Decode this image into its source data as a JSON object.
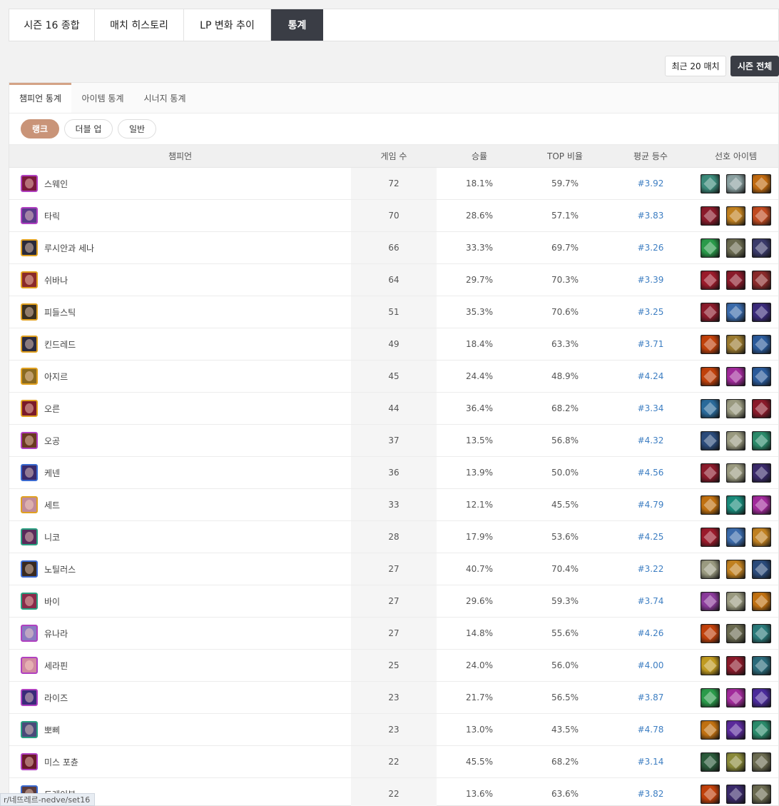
{
  "top_tabs": [
    {
      "label": "시즌 16 종합",
      "active": false
    },
    {
      "label": "매치 히스토리",
      "active": false
    },
    {
      "label": "LP 변화 추이",
      "active": false
    },
    {
      "label": "통계",
      "active": true
    }
  ],
  "range_buttons": {
    "recent": "최근 20 매치",
    "season": "시즌 전체"
  },
  "sub_tabs": [
    {
      "label": "챔피언 통계",
      "active": true
    },
    {
      "label": "아이템 통계",
      "active": false
    },
    {
      "label": "시너지 통계",
      "active": false
    }
  ],
  "queue_filters": [
    {
      "label": "랭크",
      "active": true
    },
    {
      "label": "더블 업",
      "active": false
    },
    {
      "label": "일반",
      "active": false
    }
  ],
  "table": {
    "headers": {
      "champion": "챔피언",
      "games": "게임 수",
      "winrate": "승률",
      "top_rate": "TOP 비율",
      "avg_place": "평균 등수",
      "items": "선호 아이템"
    },
    "rows": [
      {
        "name": "스웨인",
        "games": "72",
        "winrate": "18.1%",
        "top": "59.7%",
        "avg": "#3.92",
        "tier_color": "#b040c0",
        "icon_color": "#7a1a3a",
        "items": [
          {
            "icon": "item-icon",
            "color": "#3b8a7a"
          },
          {
            "icon": "item-icon",
            "color": "#8aa0a0"
          },
          {
            "icon": "item-icon",
            "color": "#c06a10"
          }
        ]
      },
      {
        "name": "타릭",
        "games": "70",
        "winrate": "28.6%",
        "top": "57.1%",
        "avg": "#3.83",
        "tier_color": "#b040c0",
        "icon_color": "#5a3a8a",
        "items": [
          {
            "icon": "item-icon",
            "color": "#8a1a2a"
          },
          {
            "icon": "item-icon",
            "color": "#c08020"
          },
          {
            "icon": "item-icon",
            "color": "#c04a20"
          }
        ]
      },
      {
        "name": "루시안과 세나",
        "games": "66",
        "winrate": "33.3%",
        "top": "69.7%",
        "avg": "#3.26",
        "tier_color": "#e0a020",
        "icon_color": "#2a2a3a",
        "items": [
          {
            "icon": "item-icon",
            "color": "#2a9a4a"
          },
          {
            "icon": "item-icon",
            "color": "#6a6a50"
          },
          {
            "icon": "item-icon",
            "color": "#3a3a6a"
          }
        ]
      },
      {
        "name": "쉬바나",
        "games": "64",
        "winrate": "29.7%",
        "top": "70.3%",
        "avg": "#3.39",
        "tier_color": "#e0a020",
        "icon_color": "#8a2a2a",
        "items": [
          {
            "icon": "item-icon",
            "color": "#9a1a2a"
          },
          {
            "icon": "item-icon",
            "color": "#8a1a2a"
          },
          {
            "icon": "item-icon",
            "color": "#8a2a2a"
          }
        ]
      },
      {
        "name": "피들스틱",
        "games": "51",
        "winrate": "35.3%",
        "top": "70.6%",
        "avg": "#3.25",
        "tier_color": "#e0a020",
        "icon_color": "#3a3020",
        "items": [
          {
            "icon": "item-icon",
            "color": "#8a1a2a"
          },
          {
            "icon": "item-icon",
            "color": "#3a6aaa"
          },
          {
            "icon": "item-icon",
            "color": "#3a2a7a"
          }
        ]
      },
      {
        "name": "킨드레드",
        "games": "49",
        "winrate": "18.4%",
        "top": "63.3%",
        "avg": "#3.71",
        "tier_color": "#e0a020",
        "icon_color": "#2a2a40",
        "items": [
          {
            "icon": "item-icon",
            "color": "#c0400a"
          },
          {
            "icon": "item-icon",
            "color": "#9a7a30"
          },
          {
            "icon": "item-icon",
            "color": "#2a5a9a"
          }
        ]
      },
      {
        "name": "아지르",
        "games": "45",
        "winrate": "24.4%",
        "top": "48.9%",
        "avg": "#4.24",
        "tier_color": "#e0a020",
        "icon_color": "#8a6a20",
        "items": [
          {
            "icon": "item-icon",
            "color": "#c0400a"
          },
          {
            "icon": "item-icon",
            "color": "#a02a9a"
          },
          {
            "icon": "item-icon",
            "color": "#2a5a9a"
          }
        ]
      },
      {
        "name": "오른",
        "games": "44",
        "winrate": "36.4%",
        "top": "68.2%",
        "avg": "#3.34",
        "tier_color": "#e0a020",
        "icon_color": "#7a1a2a",
        "items": [
          {
            "icon": "item-icon",
            "color": "#2a6a9a"
          },
          {
            "icon": "item-icon",
            "color": "#9a9a80"
          },
          {
            "icon": "item-icon",
            "color": "#8a1a2a"
          }
        ]
      },
      {
        "name": "오공",
        "games": "37",
        "winrate": "13.5%",
        "top": "56.8%",
        "avg": "#4.32",
        "tier_color": "#b040c0",
        "icon_color": "#6a3a20",
        "items": [
          {
            "icon": "item-icon",
            "color": "#2a4a7a"
          },
          {
            "icon": "item-icon",
            "color": "#9a9a80"
          },
          {
            "icon": "item-icon",
            "color": "#2a8a6a"
          }
        ]
      },
      {
        "name": "케넨",
        "games": "36",
        "winrate": "13.9%",
        "top": "50.0%",
        "avg": "#4.56",
        "tier_color": "#3a6ad0",
        "icon_color": "#3a2a6a",
        "items": [
          {
            "icon": "item-icon",
            "color": "#8a1a2a"
          },
          {
            "icon": "item-icon",
            "color": "#9a9a80"
          },
          {
            "icon": "item-icon",
            "color": "#3a2a6a"
          }
        ]
      },
      {
        "name": "세트",
        "games": "33",
        "winrate": "12.1%",
        "top": "45.5%",
        "avg": "#4.79",
        "tier_color": "#e0a020",
        "icon_color": "#c08a9a",
        "items": [
          {
            "icon": "item-icon",
            "color": "#c07010"
          },
          {
            "icon": "item-icon",
            "color": "#1a8a7a"
          },
          {
            "icon": "item-icon",
            "color": "#a02a9a"
          }
        ]
      },
      {
        "name": "니코",
        "games": "28",
        "winrate": "17.9%",
        "top": "53.6%",
        "avg": "#4.25",
        "tier_color": "#2aa080",
        "icon_color": "#5a2a5a",
        "items": [
          {
            "icon": "item-icon",
            "color": "#9a1a2a"
          },
          {
            "icon": "item-icon",
            "color": "#3a6aaa"
          },
          {
            "icon": "item-icon",
            "color": "#c08020"
          }
        ]
      },
      {
        "name": "노틸러스",
        "games": "27",
        "winrate": "40.7%",
        "top": "70.4%",
        "avg": "#3.22",
        "tier_color": "#3a6ad0",
        "icon_color": "#3a2a20",
        "items": [
          {
            "icon": "item-icon",
            "color": "#9a9a80"
          },
          {
            "icon": "item-icon",
            "color": "#c08020"
          },
          {
            "icon": "item-icon",
            "color": "#2a4a7a"
          }
        ]
      },
      {
        "name": "바이",
        "games": "27",
        "winrate": "29.6%",
        "top": "59.3%",
        "avg": "#3.74",
        "tier_color": "#2aa080",
        "icon_color": "#8a2a4a",
        "items": [
          {
            "icon": "item-icon",
            "color": "#8a3a9a"
          },
          {
            "icon": "item-icon",
            "color": "#9a9a80"
          },
          {
            "icon": "item-icon",
            "color": "#c07010"
          }
        ]
      },
      {
        "name": "유나라",
        "games": "27",
        "winrate": "14.8%",
        "top": "55.6%",
        "avg": "#4.26",
        "tier_color": "#b040c0",
        "icon_color": "#8a7ac0",
        "items": [
          {
            "icon": "item-icon",
            "color": "#c0400a"
          },
          {
            "icon": "item-icon",
            "color": "#6a6a50"
          },
          {
            "icon": "item-icon",
            "color": "#2a7a7a"
          }
        ]
      },
      {
        "name": "세라핀",
        "games": "25",
        "winrate": "24.0%",
        "top": "56.0%",
        "avg": "#4.00",
        "tier_color": "#b040c0",
        "icon_color": "#d08aa0",
        "items": [
          {
            "icon": "item-icon",
            "color": "#c09a20"
          },
          {
            "icon": "item-icon",
            "color": "#8a1a2a"
          },
          {
            "icon": "item-icon",
            "color": "#2a6a7a"
          }
        ]
      },
      {
        "name": "라이즈",
        "games": "23",
        "winrate": "21.7%",
        "top": "56.5%",
        "avg": "#3.87",
        "tier_color": "#b040c0",
        "icon_color": "#3a2a7a",
        "items": [
          {
            "icon": "item-icon",
            "color": "#2a9a4a"
          },
          {
            "icon": "item-icon",
            "color": "#a02a9a"
          },
          {
            "icon": "item-icon",
            "color": "#4a2a9a"
          }
        ]
      },
      {
        "name": "뽀삐",
        "games": "23",
        "winrate": "13.0%",
        "top": "43.5%",
        "avg": "#4.78",
        "tier_color": "#2aa080",
        "icon_color": "#4a4a7a",
        "items": [
          {
            "icon": "item-icon",
            "color": "#c07010"
          },
          {
            "icon": "item-icon",
            "color": "#5a2a9a"
          },
          {
            "icon": "item-icon",
            "color": "#2a8a6a"
          }
        ]
      },
      {
        "name": "미스 포츈",
        "games": "22",
        "winrate": "45.5%",
        "top": "68.2%",
        "avg": "#3.14",
        "tier_color": "#b040c0",
        "icon_color": "#6a1a2a",
        "items": [
          {
            "icon": "item-icon",
            "color": "#2a5a3a"
          },
          {
            "icon": "item-icon",
            "color": "#8a8a3a"
          },
          {
            "icon": "item-icon",
            "color": "#6a6a50"
          }
        ]
      },
      {
        "name": "드레이븐",
        "games": "22",
        "winrate": "13.6%",
        "top": "63.6%",
        "avg": "#3.82",
        "tier_color": "#3a6ad0",
        "icon_color": "#5a3a3a",
        "items": [
          {
            "icon": "item-icon",
            "color": "#c0400a"
          },
          {
            "icon": "item-icon",
            "color": "#3a2a6a"
          },
          {
            "icon": "item-icon",
            "color": "#6a6a50"
          }
        ]
      }
    ]
  },
  "status_url": "r/네뜨레르-nedve/set16"
}
